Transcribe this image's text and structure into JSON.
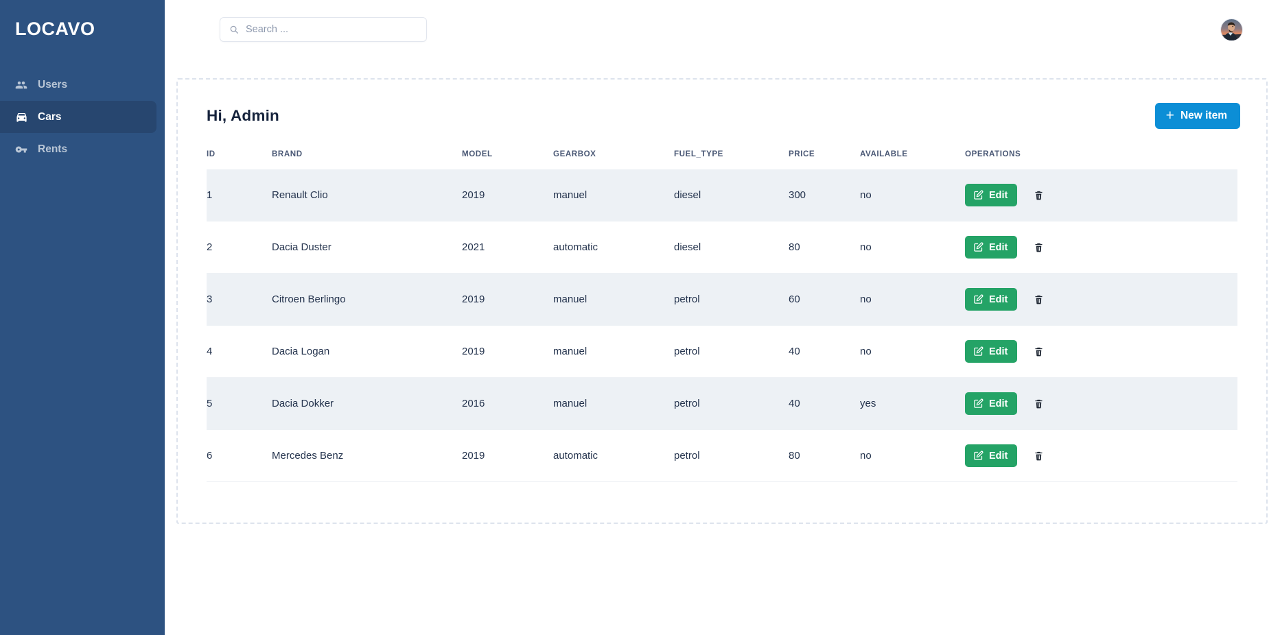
{
  "sidebar": {
    "brand": "LOCAVO",
    "items": [
      {
        "label": "Users",
        "icon": "users-icon",
        "active": false
      },
      {
        "label": "Cars",
        "icon": "car-icon",
        "active": true
      },
      {
        "label": "Rents",
        "icon": "keys-icon",
        "active": false
      }
    ],
    "colors": {
      "background": "#2d5281",
      "active_background": "#27466f",
      "text": "#b9c6d6",
      "active_text": "#ffffff"
    }
  },
  "topbar": {
    "search": {
      "placeholder": "Search ...",
      "value": "",
      "icon": "search-icon"
    },
    "avatar": {
      "name": "user-avatar"
    }
  },
  "panel": {
    "title": "Hi, Admin",
    "new_item": {
      "label": "New item",
      "icon": "plus-icon",
      "color": "#0c8ed6"
    }
  },
  "table": {
    "columns": [
      "ID",
      "BRAND",
      "MODEL",
      "GEARBOX",
      "FUEL_TYPE",
      "PRICE",
      "AVAILABLE",
      "OPERATIONS"
    ],
    "rows": [
      {
        "id": "1",
        "brand": "Renault Clio",
        "model": "2019",
        "gearbox": "manuel",
        "fuel_type": "diesel",
        "price": "300",
        "available": "no"
      },
      {
        "id": "2",
        "brand": "Dacia Duster",
        "model": "2021",
        "gearbox": "automatic",
        "fuel_type": "diesel",
        "price": "80",
        "available": "no"
      },
      {
        "id": "3",
        "brand": "Citroen Berlingo",
        "model": "2019",
        "gearbox": "manuel",
        "fuel_type": "petrol",
        "price": "60",
        "available": "no"
      },
      {
        "id": "4",
        "brand": "Dacia Logan",
        "model": "2019",
        "gearbox": "manuel",
        "fuel_type": "petrol",
        "price": "40",
        "available": "no"
      },
      {
        "id": "5",
        "brand": "Dacia Dokker",
        "model": "2016",
        "gearbox": "manuel",
        "fuel_type": "petrol",
        "price": "40",
        "available": "yes"
      },
      {
        "id": "6",
        "brand": "Mercedes Benz",
        "model": "2019",
        "gearbox": "automatic",
        "fuel_type": "petrol",
        "price": "80",
        "available": "no"
      }
    ],
    "operations": {
      "edit_label": "Edit",
      "edit_icon": "edit-square-icon",
      "edit_color": "#24a366",
      "delete_icon": "trash-icon"
    }
  }
}
